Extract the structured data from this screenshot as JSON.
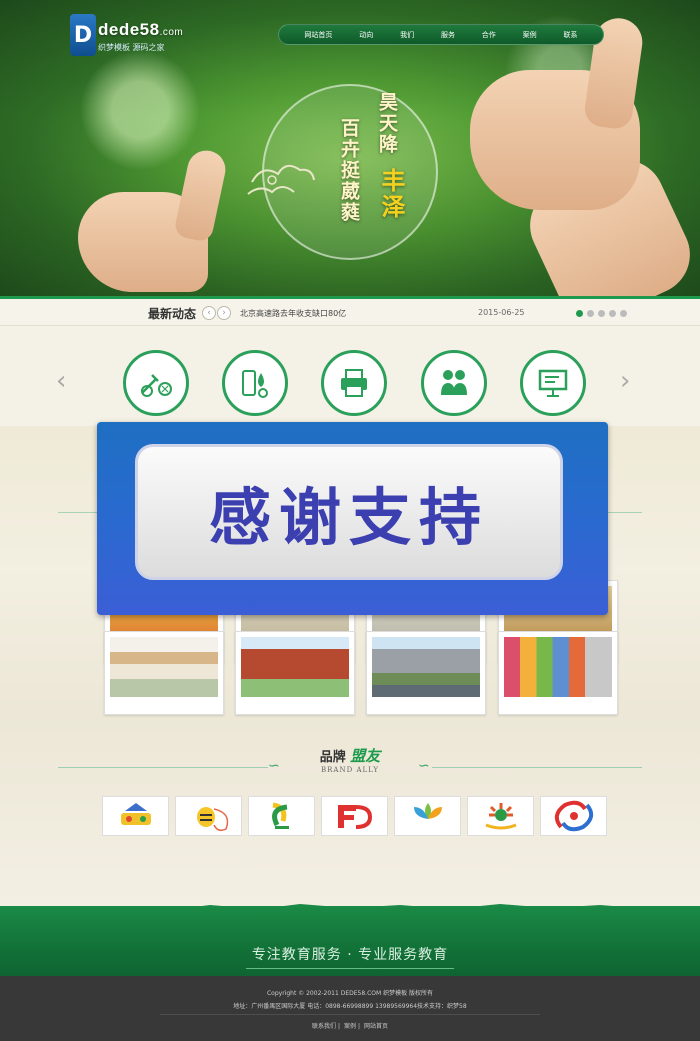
{
  "site": {
    "logo_text": "dede58",
    "logo_suffix": ".com",
    "logo_sub": "织梦模板 源码之家"
  },
  "nav": {
    "items": [
      "网站首页",
      "动向",
      "我们",
      "服务",
      "合作",
      "案例",
      "联系"
    ]
  },
  "hero": {
    "motto_line1": "百卉挺葳蕤",
    "motto_line2": "昊天降",
    "motto_line3": "丰泽"
  },
  "news": {
    "title": "最新动态",
    "prev_icon": "chevron-left-icon",
    "next_icon": "chevron-right-icon",
    "headline": "北京高速路去年收支缺口80亿",
    "date": "2015-06-25",
    "slide_count": 5,
    "active_slide": 1
  },
  "services": {
    "icons": [
      "guitar-ball-icon",
      "science-flask-icon",
      "printer-icon",
      "children-icon",
      "presentation-board-icon"
    ],
    "accent": "#2aa05a"
  },
  "overlay": {
    "text": "感谢支持"
  },
  "brand": {
    "title_plain": "品牌",
    "title_accent": "盟友",
    "subtitle": "BRAND ALLY",
    "partners": [
      "乐奇家",
      "小蜜蜂",
      "德源",
      "FeDo",
      "天池",
      "启蒙幼儿",
      "logo-7"
    ]
  },
  "band": {
    "slogan": "专注教育服务 · 专业服务教育"
  },
  "footer": {
    "copyright": "Copyright © 2002-2011 DEDE58.COM 织梦模板 版权所有",
    "address": "地址：广州番禺区国际大厦 电话：0898-66998899 13989569964技术支持：织梦58",
    "links": [
      "联系我们",
      "案例",
      "网站首页"
    ]
  },
  "colors": {
    "brand_green": "#1e9a4c",
    "footer_dark": "#383838",
    "overlay_blue": "#2a6ad0"
  }
}
